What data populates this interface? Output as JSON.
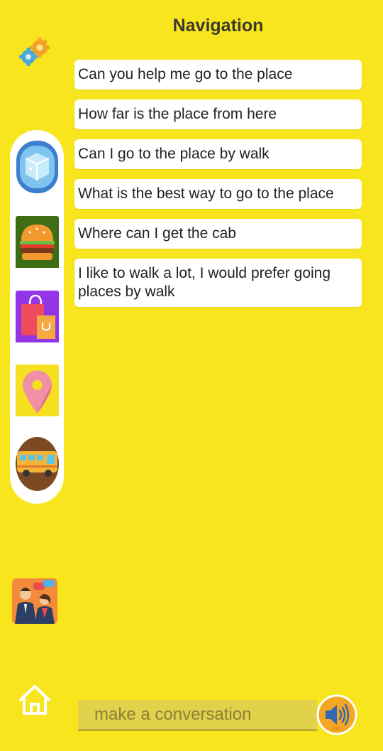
{
  "header": {
    "title": "Navigation"
  },
  "phrases": [
    "Can you help me go to the place",
    "How far is the place from here",
    "Can I go to the place by walk",
    "What is the best way to go to the place",
    "Where can I get the cab",
    "I like to walk a lot, I would prefer going places by walk"
  ],
  "sidebar": {
    "categories": [
      {
        "icon": "ice-cube-icon"
      },
      {
        "icon": "burger-icon"
      },
      {
        "icon": "shopping-bags-icon"
      },
      {
        "icon": "location-pin-icon"
      },
      {
        "icon": "bus-icon"
      }
    ],
    "bottom_icons": [
      "settings-gear-icon",
      "conversation-people-icon",
      "home-icon"
    ]
  },
  "input": {
    "placeholder": "make a conversation",
    "value": ""
  },
  "actions": {
    "speak_icon": "speaker-icon"
  },
  "colors": {
    "background": "#f8e51d",
    "card": "#ffffff",
    "input_bg": "#e2d14a",
    "speaker": "#f5a623"
  }
}
